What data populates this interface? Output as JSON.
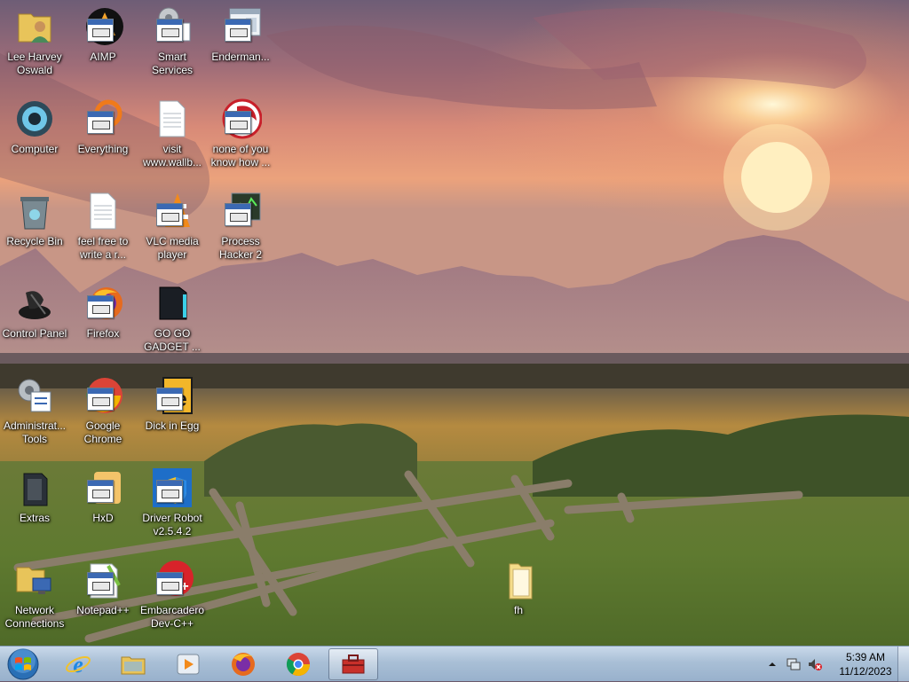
{
  "desktop": {
    "icons": [
      {
        "label": "Lee Harvey Oswald",
        "icon": "user-folder-icon"
      },
      {
        "label": "Computer",
        "icon": "computer-icon"
      },
      {
        "label": "Recycle Bin",
        "icon": "recycle-bin-icon"
      },
      {
        "label": "Control Panel",
        "icon": "control-panel-icon"
      },
      {
        "label": "Administrat... Tools",
        "icon": "admin-tools-icon"
      },
      {
        "label": "Extras",
        "icon": "extras-icon"
      },
      {
        "label": "Network Connections",
        "icon": "network-icon"
      },
      {
        "label": "AIMP",
        "icon": "aimp-icon"
      },
      {
        "label": "Everything",
        "icon": "everything-icon"
      },
      {
        "label": "feel free to write a r...",
        "icon": "text-file-icon"
      },
      {
        "label": "Firefox",
        "icon": "firefox-icon"
      },
      {
        "label": "Google Chrome",
        "icon": "chrome-icon"
      },
      {
        "label": "HxD",
        "icon": "hxd-icon"
      },
      {
        "label": "Notepad++",
        "icon": "notepadpp-icon"
      },
      {
        "label": "Smart Services",
        "icon": "services-icon"
      },
      {
        "label": "visit www.wallb...",
        "icon": "text-file-icon"
      },
      {
        "label": "VLC media player",
        "icon": "vlc-icon"
      },
      {
        "label": "GO GO GADGET ...",
        "icon": "gadget-icon"
      },
      {
        "label": "Dick in Egg",
        "icon": "egg-icon"
      },
      {
        "label": "Driver Robot v2.5.4.2",
        "icon": "driver-robot-icon"
      },
      {
        "label": "Embarcadero Dev-C++",
        "icon": "devcpp-icon"
      },
      {
        "label": "Enderman...",
        "icon": "window-icon"
      },
      {
        "label": "none of you know how ...",
        "icon": "app-icon"
      },
      {
        "label": "Process Hacker 2",
        "icon": "process-hacker-icon"
      },
      {
        "label": "fh",
        "icon": "folder-icon"
      }
    ]
  },
  "taskbar": {
    "start_icon": "windows-start-icon",
    "pinned": [
      {
        "name": "internet-explorer",
        "icon": "ie-icon"
      },
      {
        "name": "windows-explorer",
        "icon": "folder-icon"
      },
      {
        "name": "media-player",
        "icon": "media-player-icon"
      },
      {
        "name": "firefox",
        "icon": "firefox-icon"
      },
      {
        "name": "chrome",
        "icon": "chrome-icon"
      },
      {
        "name": "toolbox",
        "icon": "toolbox-icon"
      }
    ],
    "tray": {
      "time": "5:39 AM",
      "date": "11/12/2023"
    }
  },
  "colors": {
    "taskbar_top": "#c9d9ea",
    "taskbar_bottom": "#98b1cc",
    "sky_top": "#6e5d76",
    "sun": "#fff3c4"
  }
}
